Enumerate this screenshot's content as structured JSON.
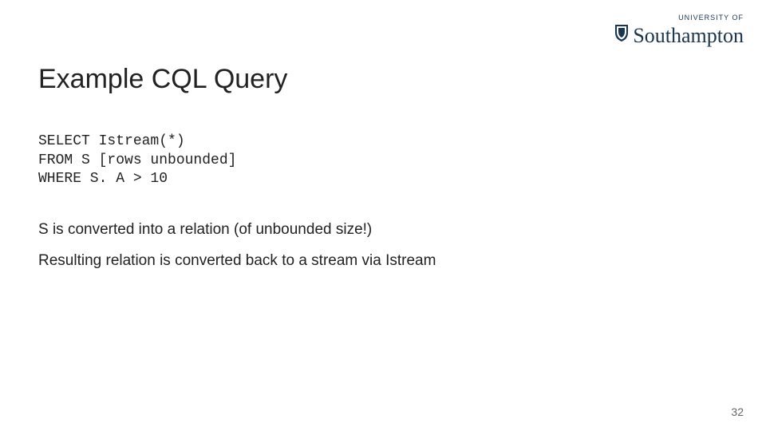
{
  "logo": {
    "superscript": "UNIVERSITY OF",
    "main": "Southampton"
  },
  "title": "Example CQL Query",
  "code_lines": [
    "SELECT Istream(*)",
    "FROM S [rows unbounded]",
    "WHERE S. A > 10"
  ],
  "body_paragraphs": [
    "S is converted into a relation (of unbounded size!)",
    "Resulting relation is converted back to a stream via Istream"
  ],
  "page_number": "32"
}
